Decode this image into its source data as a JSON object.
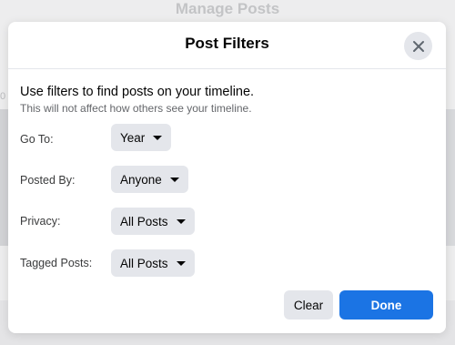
{
  "background": {
    "title": "Manage Posts",
    "stray_text": "0"
  },
  "modal": {
    "title": "Post Filters",
    "close_icon": "close-icon",
    "intro_heading": "Use filters to find posts on your timeline.",
    "intro_subtext": "This will not affect how others see your timeline.",
    "filters": [
      {
        "label": "Go To:",
        "value": "Year"
      },
      {
        "label": "Posted By:",
        "value": "Anyone"
      },
      {
        "label": "Privacy:",
        "value": "All Posts"
      },
      {
        "label": "Tagged Posts:",
        "value": "All Posts"
      }
    ],
    "clear_label": "Clear",
    "done_label": "Done"
  },
  "colors": {
    "accent": "#1b74e4",
    "button_gray": "#e4e6eb",
    "text_primary": "#050505",
    "text_secondary": "#65676b"
  }
}
